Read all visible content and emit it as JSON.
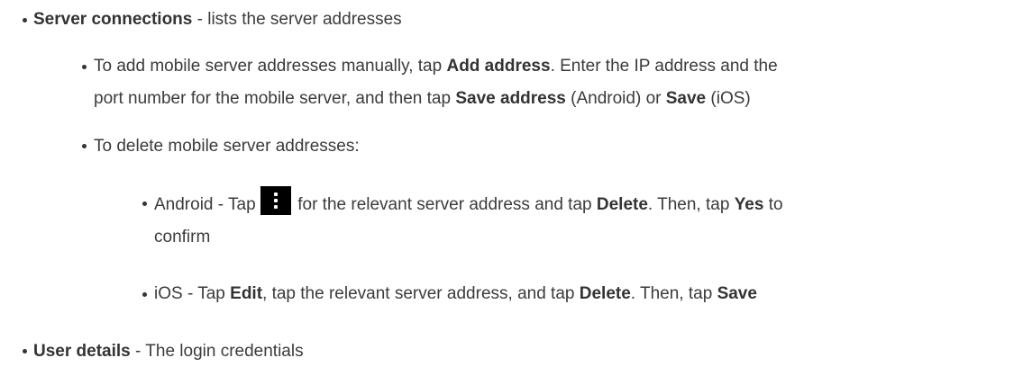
{
  "items": {
    "server_connections": {
      "title": "Server connections",
      "desc": " - lists the server addresses"
    },
    "add_address": {
      "l1_a": "To add mobile server addresses manually, tap ",
      "l1_b": "Add address",
      "l1_c": ". Enter the IP address and the",
      "l2_a": "port number for the mobile server, and then tap ",
      "l2_b": "Save address",
      "l2_c": " (Android) or ",
      "l2_d": "Save",
      "l2_e": " (iOS)"
    },
    "delete": {
      "text": "To delete mobile server addresses:"
    },
    "android": {
      "a": "Android - Tap ",
      "b": " for the relevant server address and tap ",
      "c": "Delete",
      "d": ". Then, tap ",
      "e": "Yes",
      "f": " to",
      "g": "confirm",
      "icon": "more-vert-icon"
    },
    "ios": {
      "a": "iOS - Tap ",
      "b": "Edit",
      "c": ", tap the relevant server address, and tap ",
      "d": "Delete",
      "e": ". Then, tap ",
      "f": "Save"
    },
    "user_details": {
      "title": "User details",
      "desc": " - The login credentials"
    }
  }
}
